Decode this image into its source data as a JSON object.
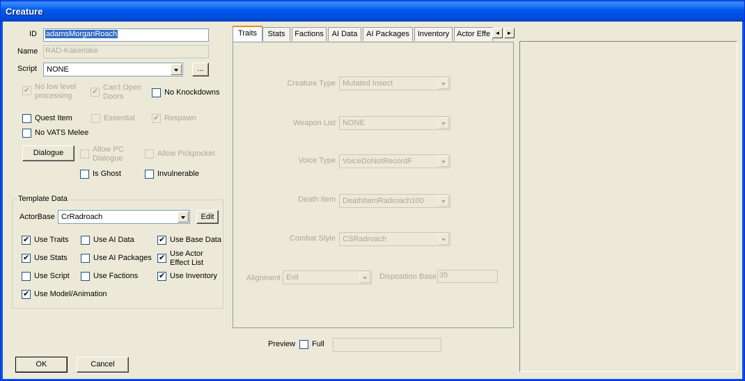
{
  "window": {
    "title": "Creature"
  },
  "basic": {
    "id_label": "ID",
    "id_value": "adamsMorganRoach",
    "name_label": "Name",
    "name_value": "RAD-Kakerlake",
    "script_label": "Script",
    "script_value": "NONE",
    "script_browse": "..."
  },
  "flags": {
    "no_low_level": {
      "line1": "No low level",
      "line2": "processing",
      "checked": true,
      "enabled": false
    },
    "cant_open_doors": {
      "line1": "Can't Open",
      "line2": "Doors",
      "checked": true,
      "enabled": false
    },
    "no_knockdowns": {
      "label": "No Knockdowns",
      "checked": false,
      "enabled": true
    },
    "quest_item": {
      "label": "Quest Item",
      "checked": false,
      "enabled": true
    },
    "essential": {
      "label": "Essential",
      "checked": false,
      "enabled": false
    },
    "respawn": {
      "label": "Respawn",
      "checked": true,
      "enabled": false
    },
    "no_vats_melee": {
      "label": "No VATS Melee",
      "checked": false,
      "enabled": true
    },
    "dialogue_button": "Dialogue",
    "allow_pc_dialogue": {
      "line1": "Allow PC",
      "line2": "Dialogue",
      "checked": false,
      "enabled": false
    },
    "allow_pickpocket": {
      "label": "Allow Pickpocket",
      "checked": false,
      "enabled": false
    },
    "is_ghost": {
      "label": "Is Ghost",
      "checked": false,
      "enabled": true
    },
    "invulnerable": {
      "label": "Invulnerable",
      "checked": false,
      "enabled": true
    }
  },
  "template": {
    "group_title": "Template Data",
    "actorbase_label": "ActorBase",
    "actorbase_value": "CrRadroach",
    "edit_button": "Edit",
    "use_traits": {
      "label": "Use Traits",
      "checked": true
    },
    "use_ai_data": {
      "label": "Use AI Data",
      "checked": false
    },
    "use_base_data": {
      "label": "Use Base Data",
      "checked": true
    },
    "use_stats": {
      "label": "Use Stats",
      "checked": true
    },
    "use_ai_packages": {
      "label": "Use AI Packages",
      "checked": false
    },
    "use_actor_effect_list": {
      "line1": "Use Actor",
      "line2": "Effect List",
      "checked": true
    },
    "use_script": {
      "label": "Use Script",
      "checked": false
    },
    "use_factions": {
      "label": "Use Factions",
      "checked": false
    },
    "use_inventory": {
      "label": "Use Inventory",
      "checked": true
    },
    "use_model_animation": {
      "label": "Use Model/Animation",
      "checked": true
    }
  },
  "tabs": [
    "Traits",
    "Stats",
    "Factions",
    "AI Data",
    "AI Packages",
    "Inventory",
    "Actor Effe"
  ],
  "tab_scroll": {
    "left": "◄",
    "right": "►"
  },
  "traits": {
    "creature_type_label": "Creature Type",
    "creature_type_value": "Mutated Insect",
    "weapon_list_label": "Weapon List",
    "weapon_list_value": "NONE",
    "voice_type_label": "Voice Type",
    "voice_type_value": "VoiceDoNotRecordF",
    "death_item_label": "Death Item",
    "death_item_value": "DeathItemRadroach100",
    "combat_style_label": "Combat Style",
    "combat_style_value": "CSRadroach",
    "alignment_label": "Alignment",
    "alignment_value": "Evil",
    "disposition_label": "Disposition Base",
    "disposition_value": "35"
  },
  "preview": {
    "label": "Preview",
    "full_label": "Full",
    "full_checked": false
  },
  "buttons": {
    "ok": "OK",
    "cancel": "Cancel"
  }
}
